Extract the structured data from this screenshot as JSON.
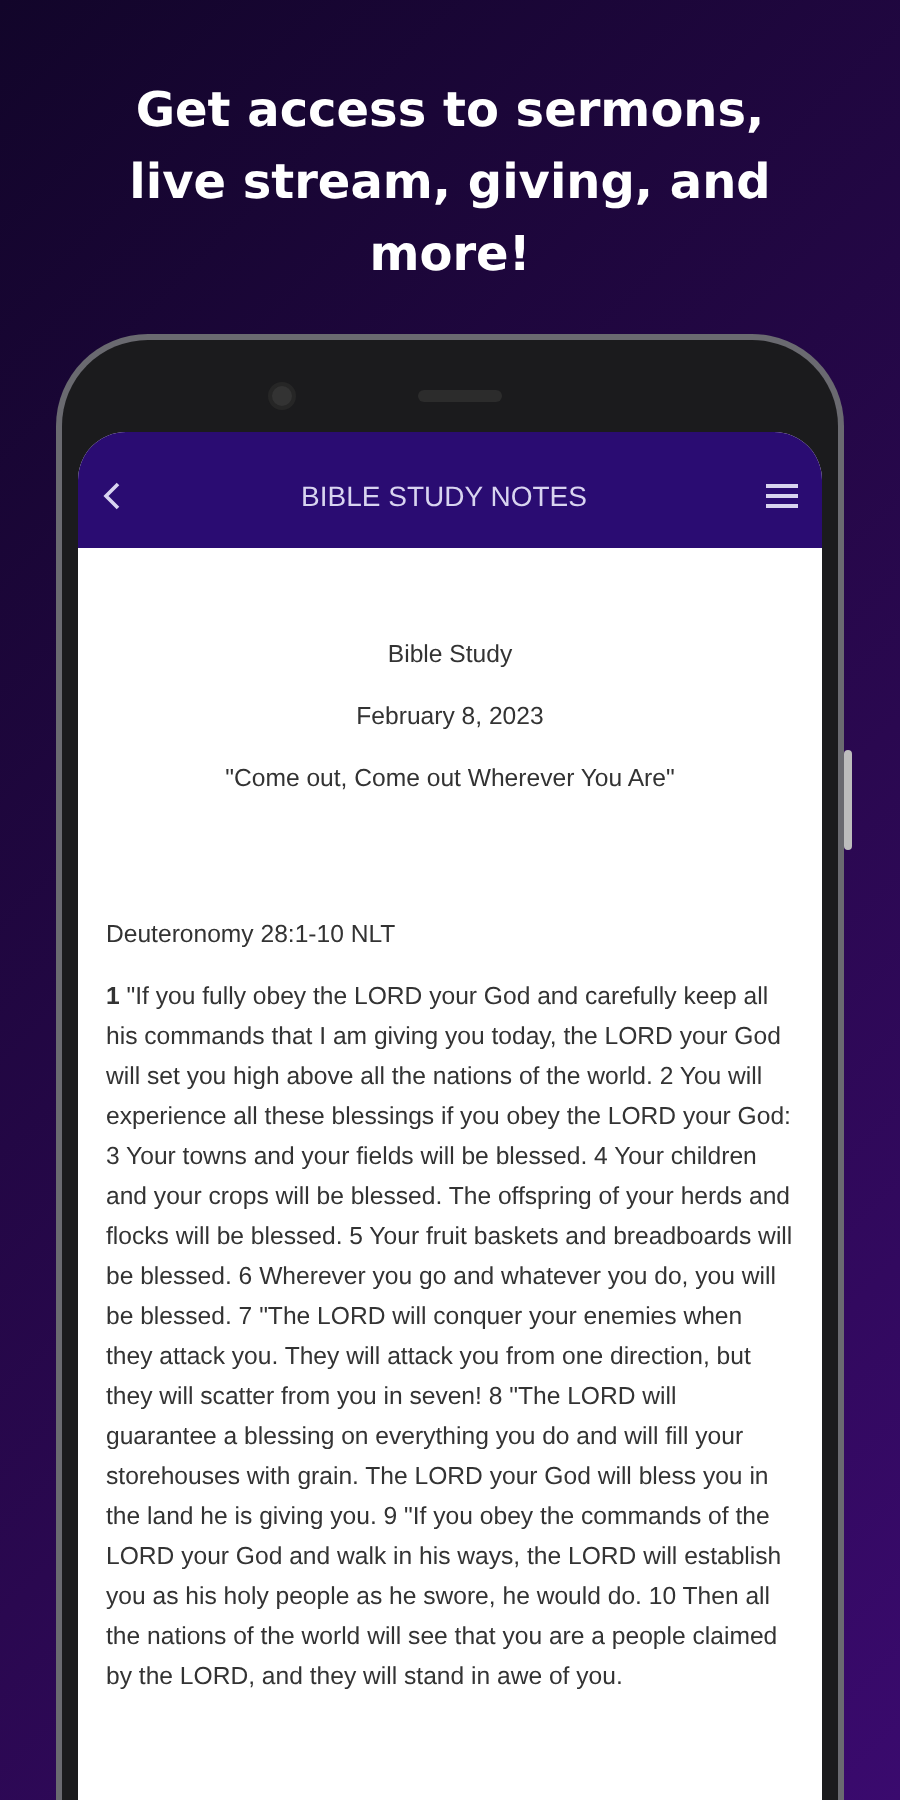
{
  "headline": "Get access to sermons, live stream, giving, and more!",
  "app_bar": {
    "title": "BIBLE STUDY NOTES"
  },
  "note": {
    "title": "Bible Study",
    "date": "February 8, 2023",
    "theme": "\"Come out, Come out Wherever You Are\"",
    "reference": "Deuteronomy 28:1-10 NLT",
    "passage": "**1** \"If you fully obey the LORD your God and carefully keep all his commands that I am giving you today, the LORD your God will set you high above all the nations of the world. 2 You will experience all these blessings if you obey the LORD your God: 3 Your towns and your fields will be blessed. 4 Your children and your crops will be blessed. The offspring of your herds and flocks will be blessed. 5 Your fruit baskets and breadboards will be blessed. 6 Wherever you go and whatever you do, you will be blessed. 7 \"The LORD will conquer your enemies when they attack you. They will attack you from one direction, but they will scatter from you in seven! 8 \"The LORD will guarantee a blessing on everything you do and will fill your storehouses with grain. The LORD your God will bless you in the land he is giving you. 9 \"If you obey the commands of the LORD your God and walk in his ways, the LORD will establish you as his holy people as he swore, he would do. 10 Then all the nations of the world will see that you are a people claimed by the LORD, and they will stand in awe of you."
  }
}
